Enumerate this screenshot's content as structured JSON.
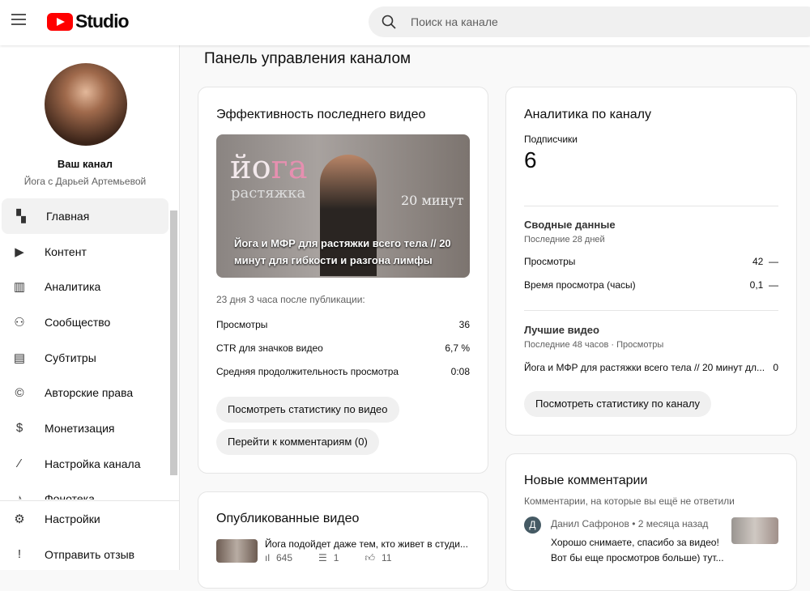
{
  "header": {
    "logo_text": "Studio",
    "search_placeholder": "Поиск на канале"
  },
  "sidebar": {
    "channel_label": "Ваш канал",
    "channel_name": "Йога с Дарьей Артемьевой",
    "items": [
      {
        "label": "Главная",
        "icon": "dashboard-icon"
      },
      {
        "label": "Контент",
        "icon": "content-icon"
      },
      {
        "label": "Аналитика",
        "icon": "analytics-icon"
      },
      {
        "label": "Сообщество",
        "icon": "community-icon"
      },
      {
        "label": "Субтитры",
        "icon": "subtitles-icon"
      },
      {
        "label": "Авторские права",
        "icon": "copyright-icon"
      },
      {
        "label": "Монетизация",
        "icon": "dollar-icon"
      },
      {
        "label": "Настройка канала",
        "icon": "magic-wand-icon"
      },
      {
        "label": "Фонотека",
        "icon": "audio-library-icon"
      }
    ],
    "bottom": [
      {
        "label": "Настройки",
        "icon": "gear-icon"
      },
      {
        "label": "Отправить отзыв",
        "icon": "feedback-icon"
      }
    ]
  },
  "page_title": "Панель управления каналом",
  "latest": {
    "title": "Эффективность последнего видео",
    "thumb_word1": "йо",
    "thumb_word2": "га",
    "thumb_sub": "растяжка",
    "thumb_min": "20 минут",
    "video_title": "Йога и МФР для растяжки всего тела // 20 минут для гибкости и разгона лимфы",
    "since": "23 дня 3 часа после публикации:",
    "stats": [
      {
        "label": "Просмотры",
        "value": "36"
      },
      {
        "label": "CTR для значков видео",
        "value": "6,7 %"
      },
      {
        "label": "Средняя продолжительность просмотра",
        "value": "0:08"
      }
    ],
    "btn_stats": "Посмотреть статистику по видео",
    "btn_comments": "Перейти к комментариям (0)"
  },
  "published": {
    "title": "Опубликованные видео",
    "video_title": "Йога подойдет даже тем, кто живет в студи...",
    "views": "645",
    "comments": "1",
    "likes": "11"
  },
  "analytics": {
    "title": "Аналитика по каналу",
    "subs_label": "Подписчики",
    "subs_value": "6",
    "summary_title": "Сводные данные",
    "summary_period": "Последние 28 дней",
    "rows": [
      {
        "label": "Просмотры",
        "value": "42",
        "trend": "—"
      },
      {
        "label": "Время просмотра (часы)",
        "value": "0,1",
        "trend": "—"
      }
    ],
    "top_title": "Лучшие видео",
    "top_period": "Последние 48 часов · Просмотры",
    "top_video": "Йога и МФР для растяжки всего тела // 20 минут дл...",
    "top_value": "0",
    "btn": "Посмотреть статистику по каналу"
  },
  "comments": {
    "title": "Новые комментарии",
    "subtitle": "Комментарии, на которые вы ещё не ответили",
    "avatar_letter": "Д",
    "author": "Данил Сафронов",
    "time": "• 2 месяца назад",
    "line1": "Хорошо снимаете, спасибо за видео!",
    "line2": "Вот бы еще просмотров больше) тут..."
  }
}
